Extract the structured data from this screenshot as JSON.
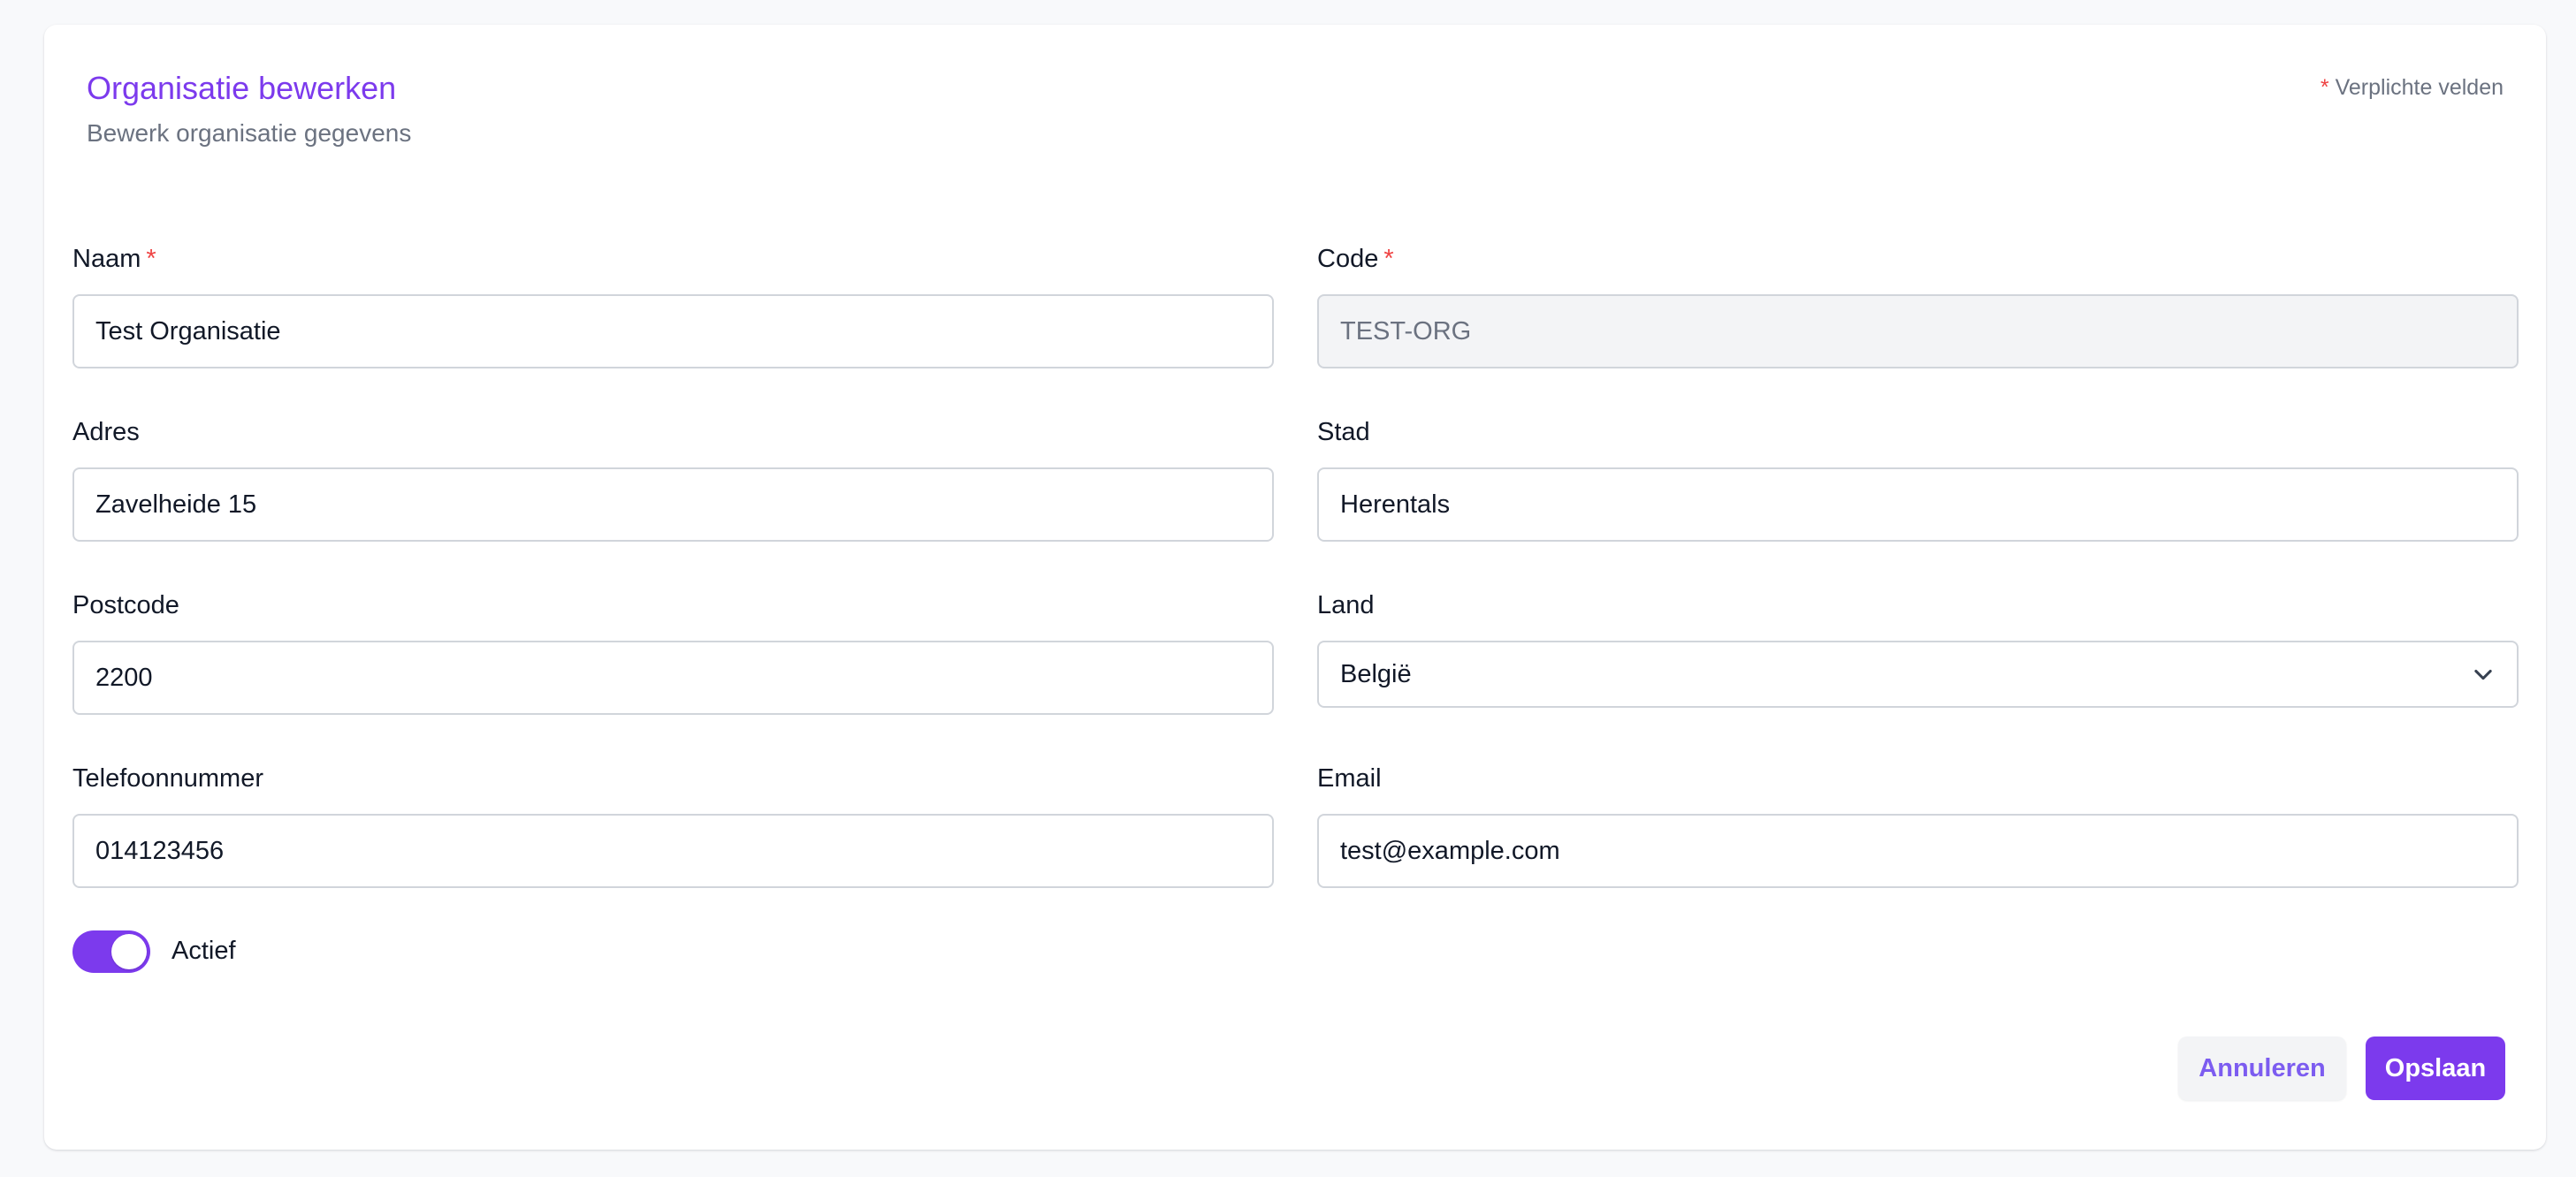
{
  "header": {
    "title": "Organisatie bewerken",
    "subtitle": "Bewerk organisatie gegevens",
    "required_star": "*",
    "required_note": "Verplichte velden"
  },
  "form": {
    "naam": {
      "label": "Naam",
      "required": "*",
      "value": "Test Organisatie"
    },
    "code": {
      "label": "Code",
      "required": "*",
      "value": "TEST-ORG"
    },
    "adres": {
      "label": "Adres",
      "value": "Zavelheide 15"
    },
    "stad": {
      "label": "Stad",
      "value": "Herentals"
    },
    "postcode": {
      "label": "Postcode",
      "value": "2200"
    },
    "land": {
      "label": "Land",
      "value": "België",
      "icon": "chevron-down-icon"
    },
    "telefoon": {
      "label": "Telefoonnummer",
      "value": "014123456"
    },
    "email": {
      "label": "Email",
      "value": "test@example.com"
    },
    "actief": {
      "label": "Actief",
      "checked": true
    }
  },
  "actions": {
    "cancel_label": "Annuleren",
    "save_label": "Opslaan"
  },
  "colors": {
    "accent": "#7c3aed",
    "required": "#ef4444",
    "muted_text": "#6b7280",
    "input_border": "#d1d5db",
    "disabled_bg": "#f3f4f6"
  }
}
